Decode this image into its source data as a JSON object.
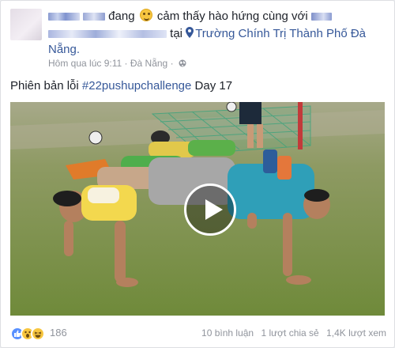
{
  "post": {
    "feeling_verb": "đang",
    "feeling_text": "cảm thấy hào hứng cùng với",
    "location_prefix": "tại",
    "location_name": "Trường Chính Trị Thành Phố Đà Nẵng.",
    "timestamp": "Hôm qua lúc 9:11",
    "place": "Đà Nẵng",
    "meta_sep": "·",
    "text_prefix": "Phiên bản lỗi",
    "hashtag": "#22pushupchallenge",
    "text_suffix": "Day 17"
  },
  "footer": {
    "reaction_count": "186",
    "comments": "10 bình luận",
    "shares": "1 lượt chia sẻ",
    "views": "1,4K lượt xem"
  },
  "colors": {
    "link": "#365899",
    "meta": "#90949c",
    "like_blue": "#5890ff",
    "reaction_yellow": "#f7c640"
  },
  "icons": [
    "excited-emoji-icon",
    "location-pin-icon",
    "globe-icon",
    "play-icon",
    "like-reaction-icon",
    "wow-reaction-icon",
    "haha-reaction-icon"
  ]
}
